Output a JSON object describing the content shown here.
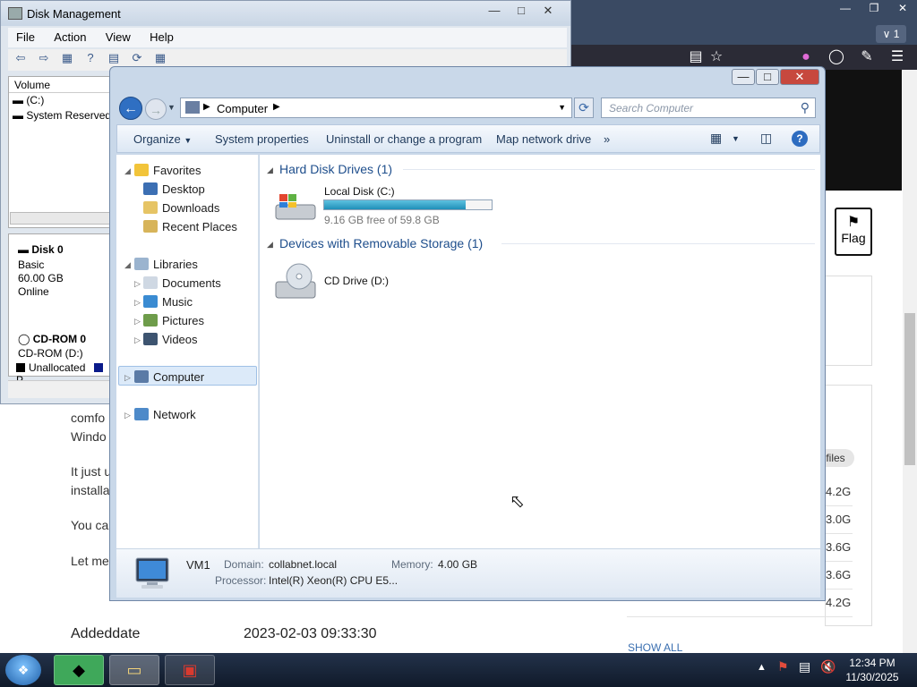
{
  "browser": {
    "tab_count": "1",
    "flag_label": "Flag",
    "files_label": "files",
    "sizes": [
      "4.2G",
      "3.0G",
      "3.6G",
      "3.6G",
      "4.2G"
    ],
    "show_all": "SHOW ALL",
    "page_text": [
      "comfo",
      "Windo",
      "It just u",
      "installa",
      "You ca",
      "Let me"
    ],
    "meta": [
      {
        "key": "Addeddate",
        "value": "2023-02-03 09:33:30"
      }
    ]
  },
  "disk_management": {
    "title": "Disk Management",
    "menu": [
      "File",
      "Action",
      "View",
      "Help"
    ],
    "list_header": "Volume",
    "volumes": [
      "(C:)",
      "System Reserved"
    ],
    "disk0": {
      "name": "Disk 0",
      "type": "Basic",
      "size": "60.00 GB",
      "status": "Online"
    },
    "cdrom": {
      "name": "CD-ROM 0",
      "drive": "CD-ROM (D:)"
    },
    "legend": [
      {
        "label": "Unallocated",
        "color": "#000000"
      },
      {
        "label": "P",
        "color": "#0a1a8a"
      }
    ]
  },
  "explorer": {
    "breadcrumb": "Computer",
    "search_placeholder": "Search Computer",
    "commands": [
      "Organize",
      "System properties",
      "Uninstall or change a program",
      "Map network drive",
      "»"
    ],
    "nav": {
      "favorites": "Favorites",
      "favorites_items": [
        "Desktop",
        "Downloads",
        "Recent Places"
      ],
      "libraries": "Libraries",
      "library_items": [
        "Documents",
        "Music",
        "Pictures",
        "Videos"
      ],
      "computer": "Computer",
      "network": "Network"
    },
    "groups": {
      "hard_disks": "Hard Disk Drives (1)",
      "removable": "Devices with Removable Storage (1)"
    },
    "local_disk": {
      "name": "Local Disk (C:)",
      "free_text": "9.16 GB free of 59.8 GB",
      "used_fraction": 0.847
    },
    "cd_drive": {
      "name": "CD Drive (D:)"
    },
    "details": {
      "computer_name": "VM1",
      "domain_label": "Domain:",
      "domain": "collabnet.local",
      "memory_label": "Memory:",
      "memory": "4.00 GB",
      "processor_label": "Processor:",
      "processor": "Intel(R) Xeon(R) CPU E5..."
    }
  },
  "taskbar": {
    "time": "12:34 PM",
    "date": "11/30/2025"
  }
}
